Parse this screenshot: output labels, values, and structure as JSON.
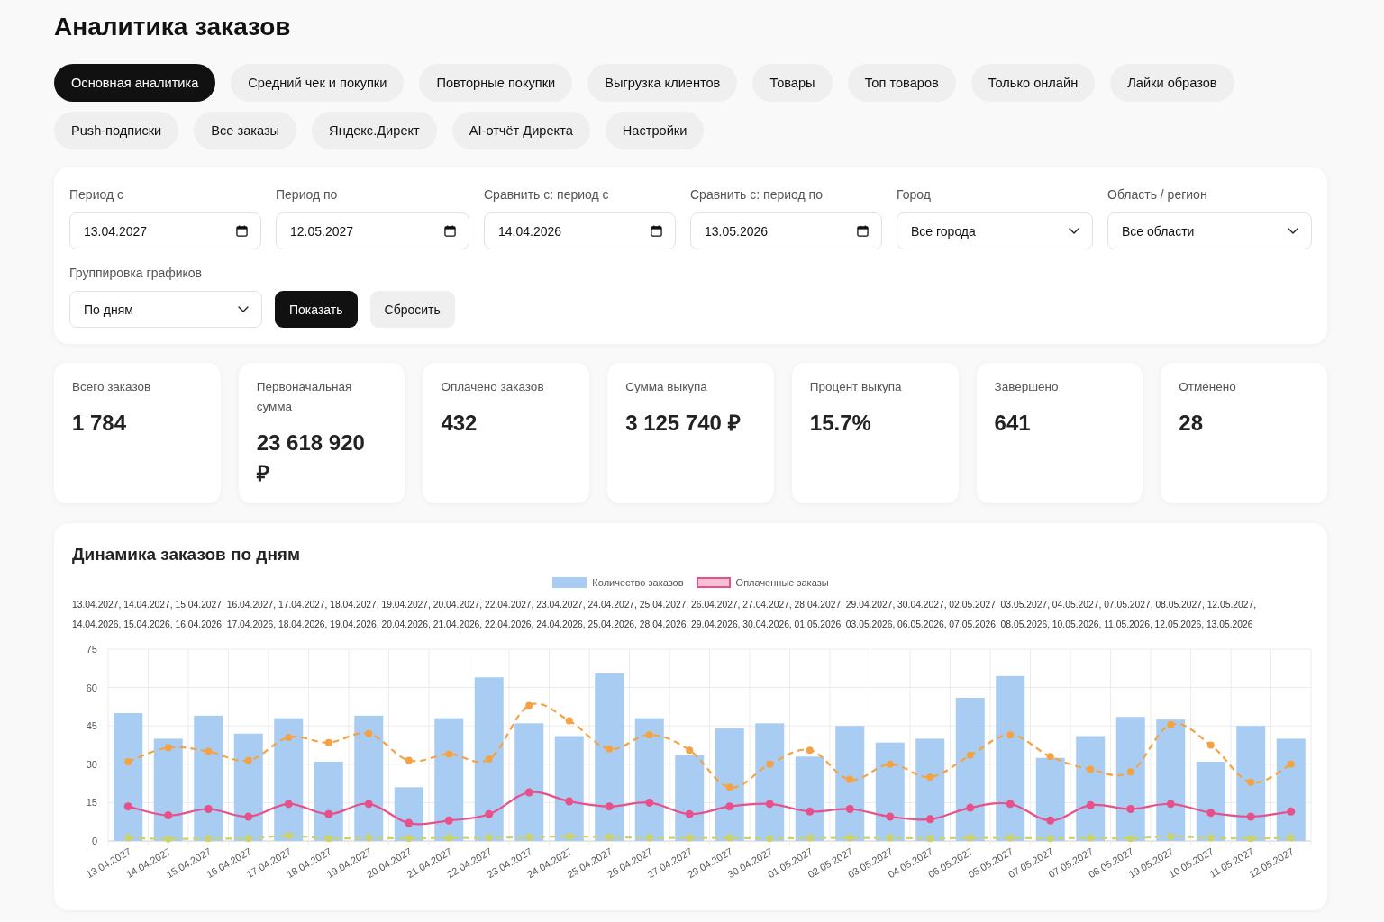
{
  "page": {
    "title": "Аналитика заказов"
  },
  "tabs": [
    {
      "label": "Основная аналитика",
      "selected": true
    },
    {
      "label": "Средний чек и покупки",
      "selected": false
    },
    {
      "label": "Повторные покупки",
      "selected": false
    },
    {
      "label": "Выгрузка клиентов",
      "selected": false
    },
    {
      "label": "Товары",
      "selected": false
    },
    {
      "label": "Топ товаров",
      "selected": false
    },
    {
      "label": "Только онлайн",
      "selected": false
    },
    {
      "label": "Лайки образов",
      "selected": false
    },
    {
      "label": "Push-подписки",
      "selected": false
    },
    {
      "label": "Все заказы",
      "selected": false
    },
    {
      "label": "Яндекс.Директ",
      "selected": false
    },
    {
      "label": "AI-отчёт Директа",
      "selected": false
    },
    {
      "label": "Настройки",
      "selected": false
    }
  ],
  "filters": {
    "fields": [
      {
        "label": "Период с",
        "kind": "date",
        "value": "13.04.2027"
      },
      {
        "label": "Период по",
        "kind": "date",
        "value": "12.05.2027"
      },
      {
        "label": "Сравнить с: период с",
        "kind": "date",
        "value": "14.04.2026"
      },
      {
        "label": "Сравнить с: период по",
        "kind": "date",
        "value": "13.05.2026"
      },
      {
        "label": "Город",
        "kind": "select",
        "value": "Все города"
      },
      {
        "label": "Область / регион",
        "kind": "select",
        "value": "Все области"
      }
    ],
    "grouping": {
      "label": "Группировка графиков",
      "kind": "select",
      "value": "По дням"
    },
    "buttons": [
      {
        "label": "Показать",
        "kind": "primary"
      },
      {
        "label": "Сбросить",
        "kind": "secondary"
      }
    ]
  },
  "stats": [
    {
      "label": "Всего заказов",
      "value": "1 784"
    },
    {
      "label": "Первоначальная сумма",
      "value": "23 618 920 ₽"
    },
    {
      "label": "Оплачено заказов",
      "value": "432"
    },
    {
      "label": "Сумма выкупа",
      "value": "3 125 740 ₽"
    },
    {
      "label": "Процент выкупа",
      "value": "15.7%"
    },
    {
      "label": "Завершено",
      "value": "641"
    },
    {
      "label": "Отменено",
      "value": "28"
    }
  ],
  "chart_panel": {
    "title": "Динамика заказов по дням",
    "date_lines": [
      "13.04.2027, 14.04.2027, 15.04.2027, 16.04.2027, 17.04.2027, 18.04.2027, 19.04.2027, 20.04.2027, 22.04.2027, 23.04.2027, 24.04.2027, 25.04.2027, 26.04.2027, 27.04.2027, 28.04.2027, 29.04.2027, 30.04.2027, 02.05.2027, 03.05.2027, 04.05.2027, 07.05.2027, 08.05.2027, 12.05.2027,",
      "14.04.2026, 15.04.2026, 16.04.2026, 17.04.2026, 18.04.2026, 19.04.2026, 20.04.2026, 21.04.2026, 22.04.2026, 24.04.2026, 25.04.2026, 28.04.2026, 29.04.2026, 30.04.2026, 01.05.2026, 03.05.2026, 06.05.2026, 07.05.2026, 08.05.2026, 10.05.2026, 11.05.2026, 12.05.2026, 13.05.2026"
    ],
    "chart_data": {
      "type": "bar",
      "categories": [
        "13.04.2027",
        "14.04.2027",
        "15.04.2027",
        "16.04.2027",
        "17.04.2027",
        "18.04.2027",
        "19.04.2027",
        "20.04.2027",
        "21.04.2027",
        "22.04.2027",
        "23.04.2027",
        "24.04.2027",
        "25.04.2027",
        "26.04.2027",
        "27.04.2027",
        "29.04.2027",
        "30.04.2027",
        "01.05.2027",
        "02.05.2027",
        "03.05.2027",
        "04.05.2027",
        "06.05.2027",
        "05.05.2027",
        "07.05.2027",
        "07.05.2027",
        "08.05.2027",
        "19.05.2027",
        "10.05.2027",
        "11.05.2027",
        "12.05.2027"
      ],
      "series": [
        {
          "name": "Количество заказов",
          "color": "#a9cdf2",
          "values": [
            50,
            40,
            49,
            42,
            48,
            31,
            49,
            21,
            48,
            64,
            46,
            41,
            65.5,
            48,
            33.5,
            44,
            46,
            33,
            45,
            38.5,
            40,
            56,
            64.5,
            32.5,
            41,
            48.5,
            47.5,
            31,
            45,
            40
          ]
        },
        {
          "name": "Оплаченные заказы",
          "type": "line",
          "line_style": "solid",
          "marker": "circle",
          "color": "#e8508a",
          "values": [
            13.5,
            10,
            12.5,
            9.5,
            14.5,
            10.5,
            14.5,
            7,
            8,
            10.5,
            19,
            15.5,
            13.5,
            15,
            10.5,
            13.5,
            14.5,
            11.5,
            12.5,
            9.5,
            8.5,
            13,
            14.5,
            8,
            14,
            12.5,
            14.5,
            11,
            9.5,
            11.5
          ]
        },
        {
          "type": "line",
          "line_style": "dashed",
          "marker": "circle",
          "color": "#f5a242",
          "values": [
            31,
            36.5,
            35,
            31.5,
            40.5,
            38.5,
            42,
            31.5,
            34,
            32,
            53,
            47,
            36,
            41.5,
            35.5,
            21,
            30,
            35.5,
            24,
            30,
            25,
            33.5,
            41.5,
            33,
            28,
            27,
            45.5,
            37.5,
            23,
            30
          ]
        },
        {
          "type": "line",
          "line_style": "dashed",
          "marker": "circle",
          "color": "#cbd26a",
          "values": [
            1.2,
            0.8,
            1,
            1,
            2,
            1,
            1.2,
            1,
            1.2,
            1.2,
            1.5,
            1.8,
            1.5,
            1.2,
            1.2,
            1.2,
            1,
            1.2,
            1.2,
            1.2,
            1,
            1.2,
            1.2,
            1,
            1.2,
            1,
            1.8,
            1.2,
            1,
            1.2
          ]
        }
      ],
      "ylim": [
        0,
        75
      ],
      "yticks": [
        0,
        15,
        30,
        45,
        60,
        75
      ],
      "grid": true
    }
  }
}
